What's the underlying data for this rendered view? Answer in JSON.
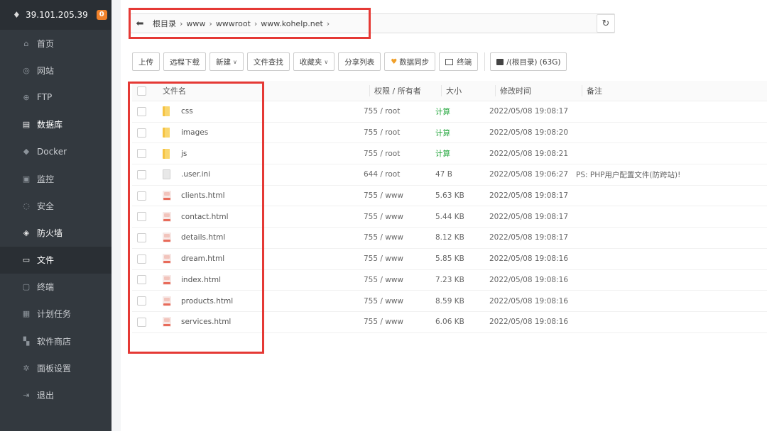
{
  "sidebar": {
    "server_ip": "39.101.205.39",
    "badge": "0",
    "items": [
      {
        "label": "首页",
        "icon": "home-icon",
        "glyph": "⌂"
      },
      {
        "label": "网站",
        "icon": "globe-icon",
        "glyph": "◎"
      },
      {
        "label": "FTP",
        "icon": "ftp-icon",
        "glyph": "⊕"
      },
      {
        "label": "数据库",
        "icon": "database-icon",
        "glyph": "▤"
      },
      {
        "label": "Docker",
        "icon": "docker-icon",
        "glyph": "◆"
      },
      {
        "label": "监控",
        "icon": "monitor-icon",
        "glyph": "▣"
      },
      {
        "label": "安全",
        "icon": "shield-icon",
        "glyph": "◌"
      },
      {
        "label": "防火墙",
        "icon": "firewall-icon",
        "glyph": "◈"
      },
      {
        "label": "文件",
        "icon": "folder-icon",
        "glyph": "▭"
      },
      {
        "label": "终端",
        "icon": "terminal-icon",
        "glyph": "▢"
      },
      {
        "label": "计划任务",
        "icon": "calendar-icon",
        "glyph": "▦"
      },
      {
        "label": "软件商店",
        "icon": "apps-icon",
        "glyph": "▚"
      },
      {
        "label": "面板设置",
        "icon": "gear-icon",
        "glyph": "✲"
      },
      {
        "label": "退出",
        "icon": "logout-icon",
        "glyph": "⇥"
      }
    ]
  },
  "path": {
    "crumbs": [
      "根目录",
      "www",
      "wwwroot",
      "www.kohelp.net"
    ]
  },
  "toolbar": {
    "upload": "上传",
    "remote_download": "远程下载",
    "new": "新建",
    "file_search": "文件查找",
    "favorites": "收藏夹",
    "share_list": "分享列表",
    "data_sync": "数据同步",
    "terminal": "终端",
    "disk": "/(根目录) (63G)"
  },
  "table": {
    "headers": {
      "name": "文件名",
      "perm": "权限 / 所有者",
      "size": "大小",
      "time": "修改时间",
      "note": "备注"
    },
    "rows": [
      {
        "type": "folder",
        "name": "css",
        "perm": "755 / root",
        "size": "计算",
        "time": "2022/05/08 19:08:17",
        "note": ""
      },
      {
        "type": "folder",
        "name": "images",
        "perm": "755 / root",
        "size": "计算",
        "time": "2022/05/08 19:08:20",
        "note": ""
      },
      {
        "type": "folder",
        "name": "js",
        "perm": "755 / root",
        "size": "计算",
        "time": "2022/05/08 19:08:21",
        "note": ""
      },
      {
        "type": "file",
        "name": ".user.ini",
        "perm": "644 / root",
        "size": "47 B",
        "time": "2022/05/08 19:06:27",
        "note": "PS: PHP用户配置文件(防跨站)!"
      },
      {
        "type": "html",
        "name": "clients.html",
        "perm": "755 / www",
        "size": "5.63 KB",
        "time": "2022/05/08 19:08:17",
        "note": ""
      },
      {
        "type": "html",
        "name": "contact.html",
        "perm": "755 / www",
        "size": "5.44 KB",
        "time": "2022/05/08 19:08:17",
        "note": ""
      },
      {
        "type": "html",
        "name": "details.html",
        "perm": "755 / www",
        "size": "8.12 KB",
        "time": "2022/05/08 19:08:17",
        "note": ""
      },
      {
        "type": "html",
        "name": "dream.html",
        "perm": "755 / www",
        "size": "5.85 KB",
        "time": "2022/05/08 19:08:16",
        "note": ""
      },
      {
        "type": "html",
        "name": "index.html",
        "perm": "755 / www",
        "size": "7.23 KB",
        "time": "2022/05/08 19:08:16",
        "note": ""
      },
      {
        "type": "html",
        "name": "products.html",
        "perm": "755 / www",
        "size": "8.59 KB",
        "time": "2022/05/08 19:08:16",
        "note": ""
      },
      {
        "type": "html",
        "name": "services.html",
        "perm": "755 / www",
        "size": "6.06 KB",
        "time": "2022/05/08 19:08:16",
        "note": ""
      }
    ]
  },
  "colors": {
    "sidebar_bg": "#33393f",
    "highlight_red": "#e53935",
    "calc_green": "#20a53a",
    "badge_orange": "#f0812a"
  }
}
